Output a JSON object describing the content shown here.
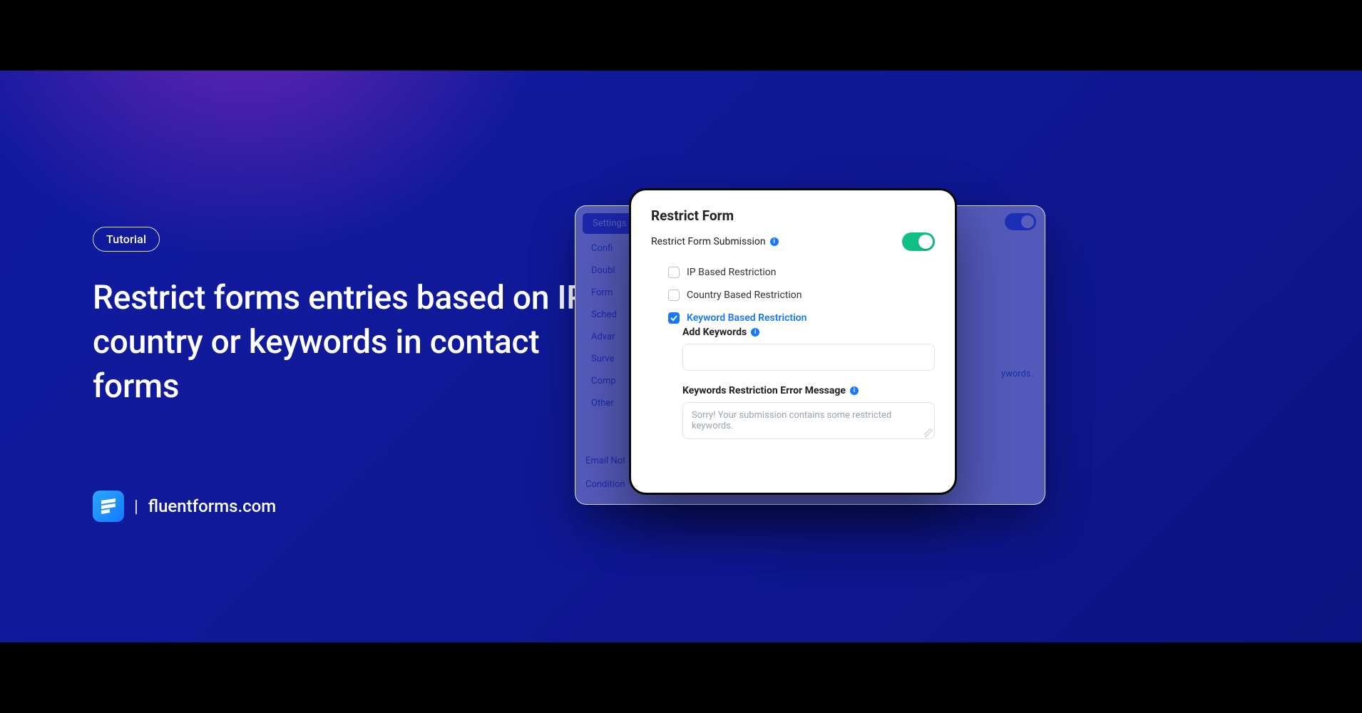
{
  "badge": {
    "label": "Tutorial"
  },
  "headline": "Restrict forms entries based on IP, country or keywords in contact forms",
  "brand": {
    "name": "fluentforms.com"
  },
  "backPanel": {
    "tab": "Settings",
    "sidebar": [
      "Confi",
      "Doubl",
      "Form",
      "Sched",
      "Advar",
      "Surve",
      "Comp",
      "Other"
    ],
    "bottom": [
      "Email Not",
      "Condition"
    ],
    "note": "ywords."
  },
  "card": {
    "title": "Restrict Form",
    "toggleLabel": "Restrict Form Submission",
    "toggleOn": true,
    "options": [
      {
        "label": "IP Based Restriction",
        "checked": false
      },
      {
        "label": "Country Based Restriction",
        "checked": false
      },
      {
        "label": "Keyword Based Restriction",
        "checked": true
      }
    ],
    "addKeywords": {
      "label": "Add Keywords"
    },
    "errorMsg": {
      "label": "Keywords Restriction Error Message",
      "placeholder": "Sorry! Your submission contains some restricted keywords."
    }
  }
}
